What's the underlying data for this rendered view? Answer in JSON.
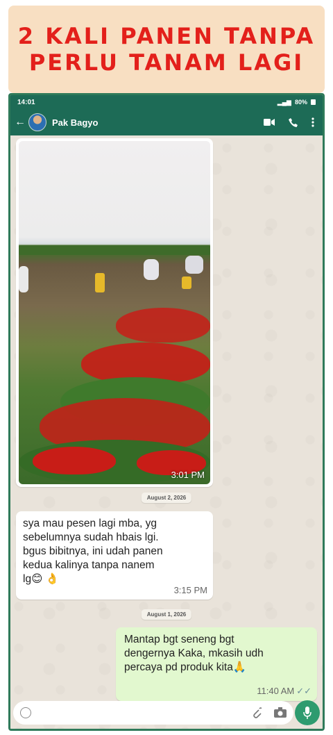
{
  "banner": {
    "line1": "2 KALI PANEN TANPA",
    "line2": "PERLU TANAM LAGI"
  },
  "status": {
    "time": "14:01",
    "battery": "80%"
  },
  "header": {
    "contact_name": "Pak Bagyo"
  },
  "messages": {
    "image": {
      "time": "3:01 PM"
    },
    "date1": "August 2, 2026",
    "incoming": {
      "text": "sya mau pesen lagi mba,  yg\nsebelumnya sudah hbais lgi.\nbgus bibitnya, ini udah panen\nkedua kalinya tanpa nanem\nlg😊 👌",
      "time": "3:15 PM"
    },
    "date2": "August 1, 2026",
    "outgoing": {
      "text": "Mantap bgt seneng bgt\ndengernya Kaka, mkasih udh\npercaya pd produk kita🙏",
      "time": "11:40 AM",
      "ticks": "✓✓"
    }
  },
  "colors": {
    "header": "#1d6b56",
    "banner_bg": "#f8dfc2",
    "banner_text": "#e3201b",
    "outgoing_bubble": "#e2f8cf",
    "chat_bg": "#e9e3da"
  },
  "icons": [
    "back-arrow-icon",
    "video-call-icon",
    "phone-call-icon",
    "more-options-icon",
    "emoji-icon",
    "attach-icon",
    "camera-icon",
    "mic-icon"
  ]
}
